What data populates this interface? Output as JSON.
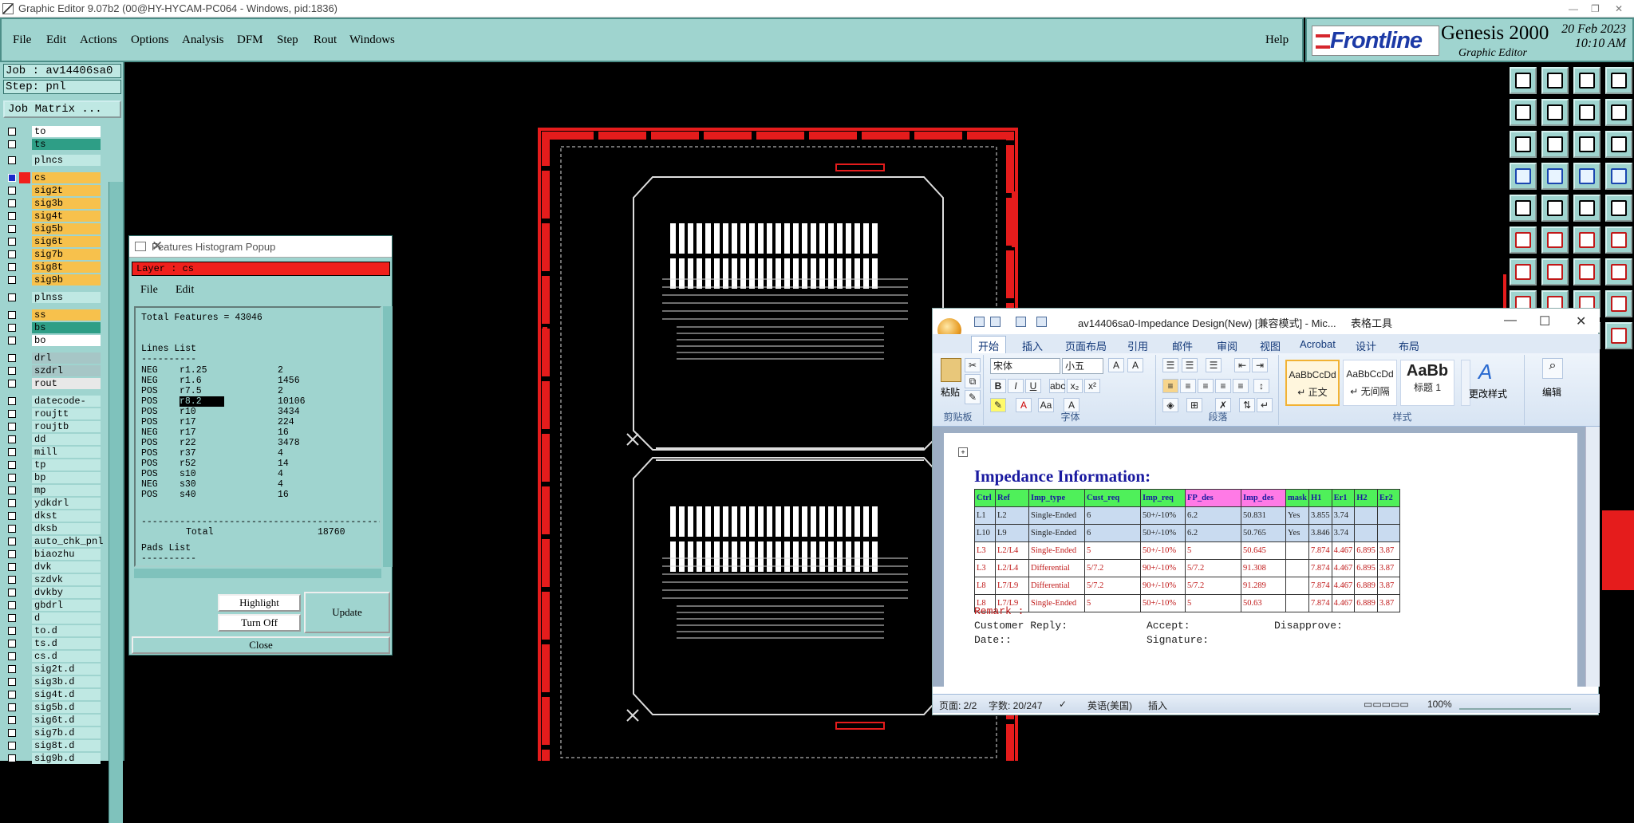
{
  "window": {
    "title": "Graphic Editor 9.07b2 (00@HY-HYCAM-PC064 - Windows, pid:1836)"
  },
  "menu": {
    "items": [
      "File",
      "Edit",
      "Actions",
      "Options",
      "Analysis",
      "DFM",
      "Step",
      "Rout",
      "Windows"
    ],
    "help": "Help"
  },
  "brand": {
    "logo": "Frontline",
    "product": "Genesis 2000",
    "subtitle": "Graphic Editor",
    "date": "20 Feb 2023",
    "time": "10:10 AM"
  },
  "left": {
    "job": "Job : av14406sa0",
    "step": "Step: pnl",
    "job_matrix": "Job Matrix ...",
    "layers": [
      "to",
      "ts",
      "plncs",
      "cs",
      "sig2t",
      "sig3b",
      "sig4t",
      "sig5b",
      "sig6t",
      "sig7b",
      "sig8t",
      "sig9b",
      "plnss",
      "ss",
      "bs",
      "bo",
      "drl",
      "szdrl",
      "rout",
      "datecode-ptn",
      "roujtt",
      "roujtb",
      "dd",
      "mill",
      "tp",
      "bp",
      "mp",
      "ydkdrl",
      "dkst",
      "dksb",
      "auto_chk_pnl",
      "biaozhu",
      "dvk",
      "szdvk",
      "dvkby",
      "gbdrl",
      "d",
      "to.d",
      "ts.d",
      "cs.d",
      "sig2t.d",
      "sig3b.d",
      "sig4t.d",
      "sig5b.d",
      "sig6t.d",
      "sig7b.d",
      "sig8t.d",
      "sig9b.d"
    ]
  },
  "popup": {
    "title": "Features Histogram Popup",
    "layer": "Layer : cs",
    "menu": [
      "File",
      "Edit"
    ],
    "total_features": "Total Features = 43046",
    "lines_header": "Lines List",
    "rows": [
      {
        "pol": "NEG",
        "sym": "r1.25",
        "count": "2"
      },
      {
        "pol": "NEG",
        "sym": "r1.6",
        "count": "1456"
      },
      {
        "pol": "POS",
        "sym": "r7.5",
        "count": "2"
      },
      {
        "pol": "POS",
        "sym": "r8.2",
        "count": "10106"
      },
      {
        "pol": "POS",
        "sym": "r10",
        "count": "3434"
      },
      {
        "pol": "POS",
        "sym": "r17",
        "count": "224"
      },
      {
        "pol": "NEG",
        "sym": "r17",
        "count": "16"
      },
      {
        "pol": "POS",
        "sym": "r22",
        "count": "3478"
      },
      {
        "pol": "POS",
        "sym": "r37",
        "count": "4"
      },
      {
        "pol": "POS",
        "sym": "r52",
        "count": "14"
      },
      {
        "pol": "POS",
        "sym": "s10",
        "count": "4"
      },
      {
        "pol": "NEG",
        "sym": "s30",
        "count": "4"
      },
      {
        "pol": "POS",
        "sym": "s40",
        "count": "16"
      }
    ],
    "total_label": "Total",
    "total_value": "18760",
    "pads_header": "Pads List",
    "buttons": {
      "highlight": "Highlight",
      "turn_off": "Turn Off",
      "update": "Update",
      "close": "Close"
    }
  },
  "word": {
    "title": "av14406sa0-Impedance Design(New) [兼容模式] - Mic...",
    "tools_tab": "表格工具",
    "tabs": [
      "开始",
      "插入",
      "页面布局",
      "引用",
      "邮件",
      "审阅",
      "视图",
      "Acrobat",
      "设计",
      "布局"
    ],
    "font_name": "宋体",
    "font_size": "小五",
    "groups": [
      "剪贴板",
      "字体",
      "段落",
      "样式",
      "编辑"
    ],
    "paste": "粘贴",
    "styles": [
      {
        "preview": "AaBbCcDd",
        "name": "↵ 正文"
      },
      {
        "preview": "AaBbCcDd",
        "name": "↵ 无间隔"
      },
      {
        "preview": "AaBb",
        "name": "标题 1"
      }
    ],
    "change_style": "更改样式",
    "edit": "编辑",
    "heading": "Impedance Information:",
    "columns": [
      "Ctrl",
      "Ref",
      "Imp_type",
      "Cust_req",
      "Imp_req",
      "FP_des",
      "Imp_des",
      "mask",
      "H1",
      "Er1",
      "H2",
      "Er2"
    ],
    "rows": [
      [
        "L1",
        "L2",
        "Single-Ended",
        "6",
        "50+/-10%",
        "6.2",
        "50.831",
        "Yes",
        "3.855",
        "3.74",
        "",
        ""
      ],
      [
        "L10",
        "L9",
        "Single-Ended",
        "6",
        "50+/-10%",
        "6.2",
        "50.765",
        "Yes",
        "3.846",
        "3.74",
        "",
        ""
      ],
      [
        "L3",
        "L2/L4",
        "Single-Ended",
        "5",
        "50+/-10%",
        "5",
        "50.645",
        "",
        "7.874",
        "4.467",
        "6.895",
        "3.87"
      ],
      [
        "L3",
        "L2/L4",
        "Differential",
        "5/7.2",
        "90+/-10%",
        "5/7.2",
        "91.308",
        "",
        "7.874",
        "4.467",
        "6.895",
        "3.87"
      ],
      [
        "L8",
        "L7/L9",
        "Differential",
        "5/7.2",
        "90+/-10%",
        "5/7.2",
        "91.289",
        "",
        "7.874",
        "4.467",
        "6.889",
        "3.87"
      ],
      [
        "L8",
        "L7/L9",
        "Single-Ended",
        "5",
        "50+/-10%",
        "5",
        "50.63",
        "",
        "7.874",
        "4.467",
        "6.889",
        "3.87"
      ]
    ],
    "remark": "Remark :",
    "customer_reply": "Customer Reply:",
    "accept": "Accept:",
    "disapprove": "Disapprove:",
    "date": "Date::",
    "signature": "Signature:",
    "status": {
      "page": "页面: 2/2",
      "words": "字数: 20/247",
      "lang": "英语(美国)",
      "mode": "插入",
      "zoom": "100%"
    }
  },
  "colors": {
    "panel": "#9fd4cf",
    "highlight_red": "#f0201c",
    "board_red": "#e51c1c"
  }
}
